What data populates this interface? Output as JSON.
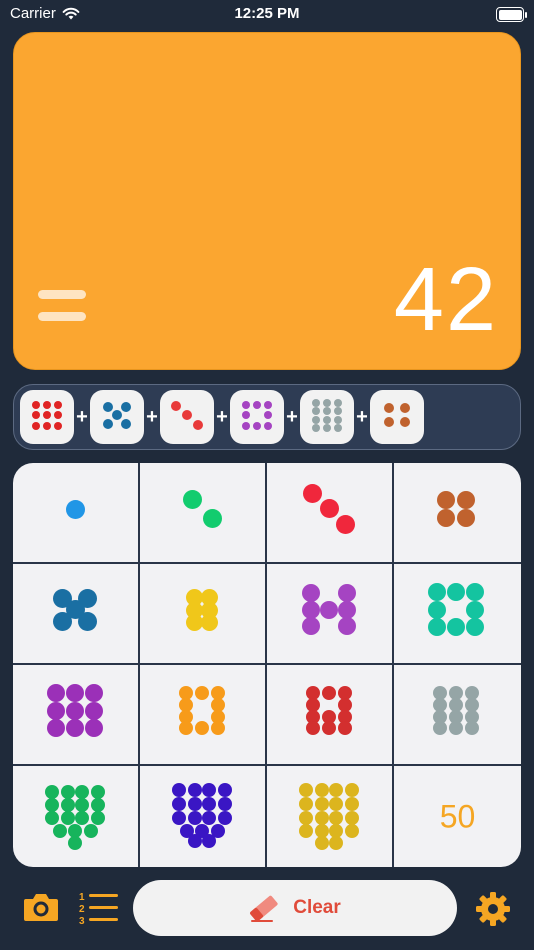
{
  "status": {
    "carrier": "Carrier",
    "time": "12:25 PM",
    "battery_level": 1.0
  },
  "display": {
    "value": "42",
    "equals_icon": "equals-icon"
  },
  "expression": [
    {
      "count": 9,
      "color": "#e02424"
    },
    {
      "count": 5,
      "color": "#1a6fa3"
    },
    {
      "count": 3,
      "color": "#e83a3a"
    },
    {
      "count": 8,
      "color": "#a544c2"
    },
    {
      "count": 12,
      "color": "#95a5a6"
    },
    {
      "count": 4,
      "color": "#c0622e"
    }
  ],
  "plus_symbol": "+",
  "dice": [
    {
      "value": 1,
      "color": "#2196e6"
    },
    {
      "value": 2,
      "color": "#12cc6e"
    },
    {
      "value": 3,
      "color": "#f0273c"
    },
    {
      "value": 4,
      "color": "#c0622e"
    },
    {
      "value": 5,
      "color": "#1a6fa3"
    },
    {
      "value": 6,
      "color": "#f0c71a"
    },
    {
      "value": 7,
      "color": "#a544c2"
    },
    {
      "value": 8,
      "color": "#14c4a0"
    },
    {
      "value": 9,
      "color": "#9b30b8"
    },
    {
      "value": 10,
      "color": "#f79b1a"
    },
    {
      "value": 11,
      "color": "#d32f2f"
    },
    {
      "value": 12,
      "color": "#95a5a6"
    },
    {
      "value": 16,
      "color": "#17b45c"
    },
    {
      "value": 17,
      "color": "#3a16c4"
    },
    {
      "value": 18,
      "color": "#dcb51e"
    }
  ],
  "number_cell": {
    "label": "50",
    "color": "#f5a623"
  },
  "toolbar": {
    "camera_icon": "camera-icon",
    "list_icon": "numbered-list-icon",
    "clear_label": "Clear",
    "eraser_icon": "eraser-icon",
    "settings_icon": "gear-icon"
  },
  "colors": {
    "accent": "#fba630",
    "background": "#1f2a3a",
    "clear_text": "#e04b3a"
  }
}
